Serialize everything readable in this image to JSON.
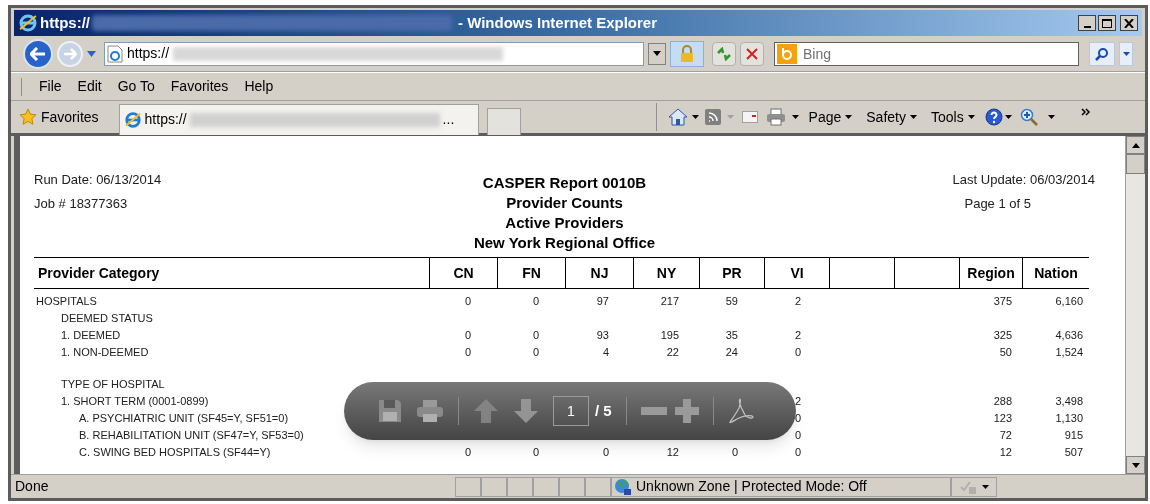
{
  "window": {
    "title_prefix": "https://",
    "title_suffix": "- Windows Internet Explorer"
  },
  "address_bar": {
    "url": "https://",
    "search_placeholder": "Bing"
  },
  "menu": [
    "File",
    "Edit",
    "Go To",
    "Favorites",
    "Help"
  ],
  "favorites_bar": {
    "label": "Favorites",
    "tab_title": "https://",
    "tab_ellipsis": "..."
  },
  "command_bar": [
    "Page",
    "Safety",
    "Tools"
  ],
  "report": {
    "run_date": "Run Date: 06/13/2014",
    "job": "Job # 18377363",
    "titles": [
      "CASPER Report 0010B",
      "Provider Counts",
      "Active Providers",
      "New York Regional Office"
    ],
    "last_update": "Last Update: 06/03/2014",
    "page": "Page 1 of 5"
  },
  "table": {
    "first_column": "Provider Category",
    "columns": [
      {
        "kind": "data",
        "label": "CN"
      },
      {
        "kind": "data",
        "label": "FN"
      },
      {
        "kind": "data",
        "label": "NJ"
      },
      {
        "kind": "data",
        "label": "NY"
      },
      {
        "kind": "data",
        "label": "PR"
      },
      {
        "kind": "data",
        "label": "VI"
      },
      {
        "kind": "blank"
      },
      {
        "kind": "blank"
      },
      {
        "kind": "data",
        "label": "Region"
      },
      {
        "kind": "data",
        "label": "Nation"
      }
    ],
    "rows": [
      {
        "label": "HOSPITALS",
        "values": [
          "0",
          "0",
          "97",
          "217",
          "59",
          "2",
          "375",
          "6,160"
        ],
        "children": [
          {
            "label": "DEEMED STATUS"
          },
          {
            "label": "1. DEEMED",
            "values": [
              "0",
              "0",
              "93",
              "195",
              "35",
              "2",
              "325",
              "4,636"
            ]
          },
          {
            "label": "1. NON-DEEMED",
            "values": [
              "0",
              "0",
              "4",
              "22",
              "24",
              "0",
              "50",
              "1,524"
            ]
          },
          {
            "label": "TYPE OF HOSPITAL",
            "gap_before": true
          },
          {
            "label": "1. SHORT TERM (0001-0899)",
            "values": [
              "2",
              "288",
              "3,498"
            ],
            "children": [
              {
                "label": "A. PSYCHIATRIC UNIT (SF45=Y, SF51=0)",
                "values": [
                  "0",
                  "123",
                  "1,130"
                ]
              },
              {
                "label": "B. REHABILITATION UNIT (SF47=Y, SF53=0)",
                "values": [
                  "0",
                  "72",
                  "915"
                ]
              },
              {
                "label": "C. SWING BED HOSPITALS (SF44=Y)",
                "values": [
                  "0",
                  "0",
                  "0",
                  "12",
                  "0",
                  "0",
                  "12",
                  "507"
                ]
              }
            ]
          }
        ]
      }
    ]
  },
  "pdf_toolbar": {
    "page_input": "1",
    "page_total": "/ 5"
  },
  "status_bar": {
    "text": "Done",
    "zone": "Unknown Zone | Protected Mode: Off"
  }
}
